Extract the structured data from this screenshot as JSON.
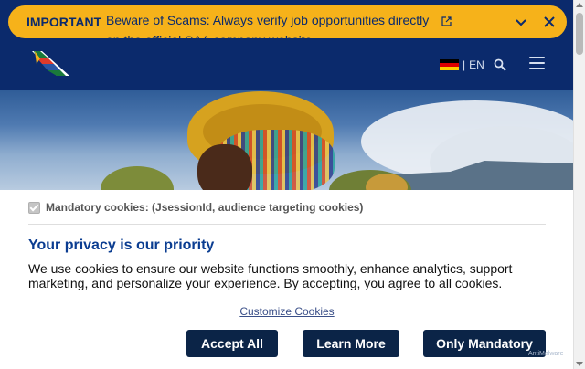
{
  "banner": {
    "tag": "IMPORTANT",
    "message": "Beware of Scams: Always verify job opportunities directly on the official SAA company website",
    "icons": [
      "external-link-icon",
      "chevron-down-icon",
      "close-icon"
    ]
  },
  "header": {
    "language": "EN",
    "language_separator": "|",
    "flag": "german-flag",
    "icons": [
      "search-icon",
      "hamburger-menu-icon"
    ],
    "colors": {
      "header_bg": "#0b2a6c",
      "banner_bg": "#f6b21a"
    }
  },
  "cookie": {
    "mandatory_label": "Mandatory cookies: (JsessionId, audience targeting cookies)",
    "mandatory_checked": true,
    "title": "Your privacy is our priority",
    "text": "We use cookies to ensure our website functions smoothly, enhance analytics, support marketing, and personalize your experience. By accepting, you agree to all cookies.",
    "customize_label": "Customize Cookies",
    "buttons": {
      "accept_all": "Accept All",
      "learn_more": "Learn More",
      "only_mandatory": "Only Mandatory"
    },
    "colors": {
      "button_bg": "#0b2447",
      "title": "#0b3d91"
    }
  },
  "watermark": "AntiMalware"
}
